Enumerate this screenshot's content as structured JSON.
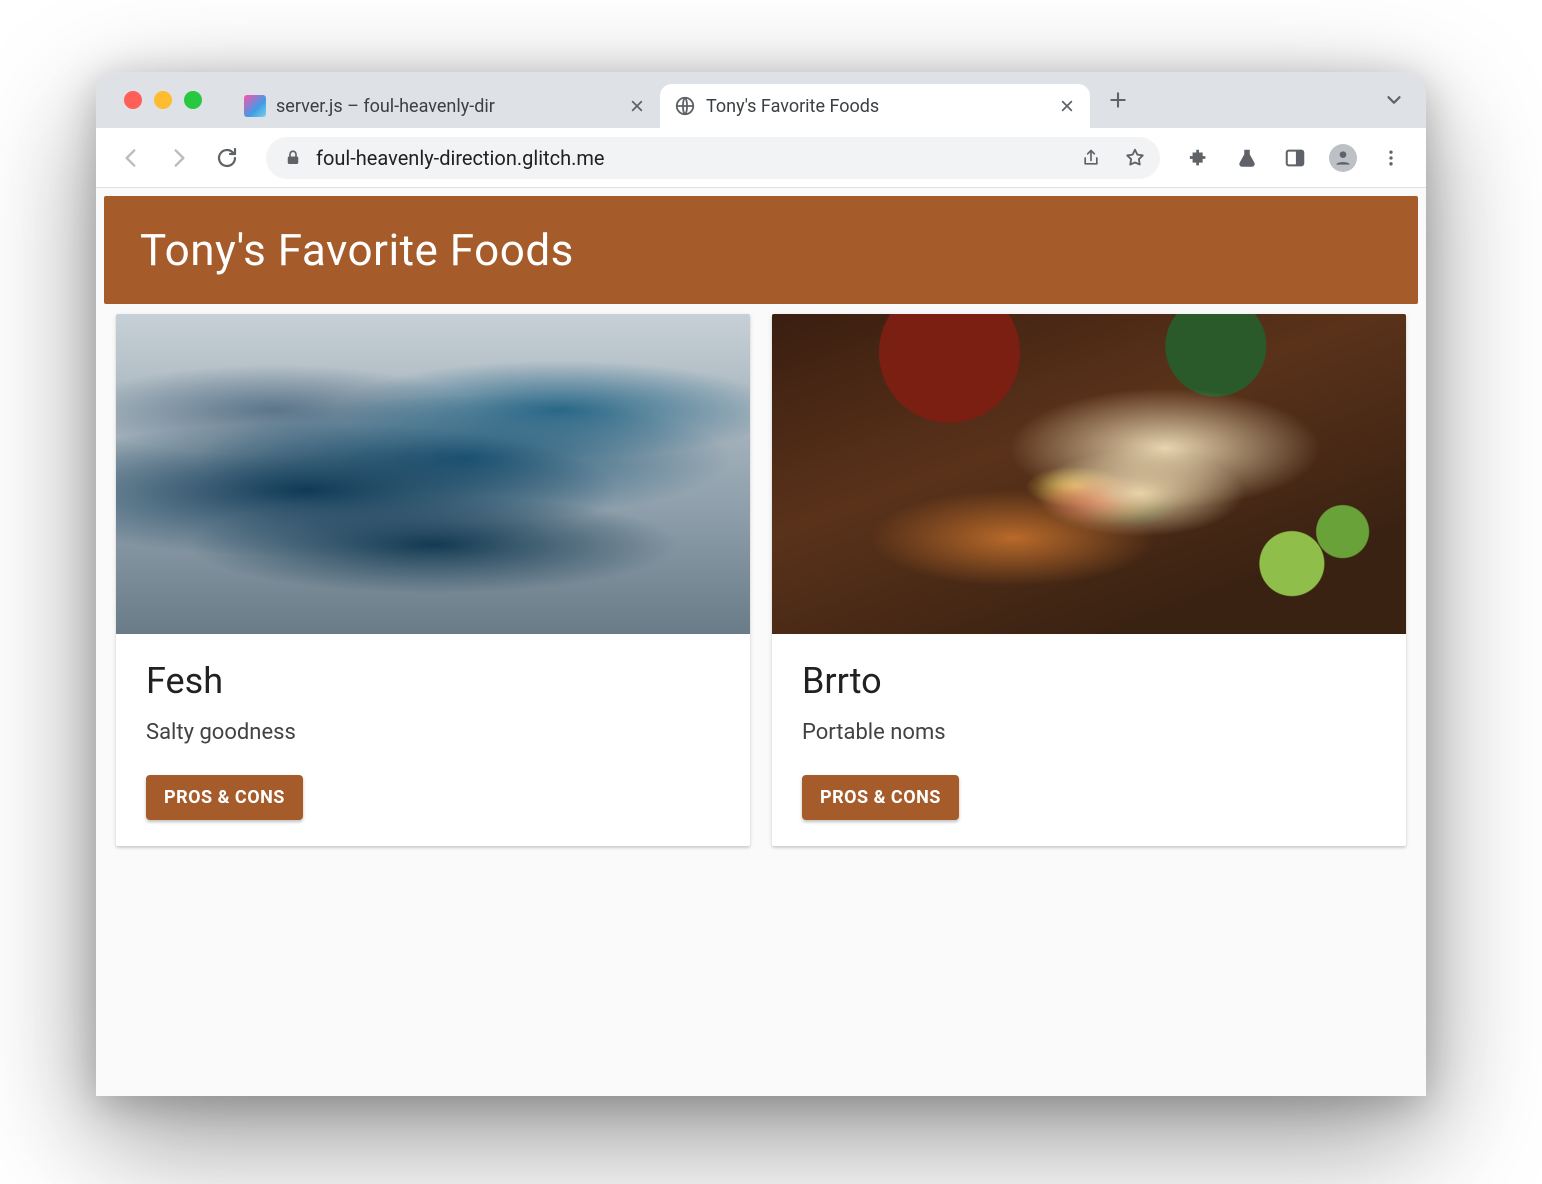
{
  "browser": {
    "tabs": [
      {
        "title": "server.js – foul-heavenly-dir",
        "active": false,
        "favicon": "glitch"
      },
      {
        "title": "Tony's Favorite Foods",
        "active": true,
        "favicon": "globe"
      }
    ],
    "url": "foul-heavenly-direction.glitch.me"
  },
  "page": {
    "title": "Tony's Favorite Foods",
    "cards": [
      {
        "title": "Fesh",
        "desc": "Salty goodness",
        "button": "PROS & CONS",
        "image": "fish"
      },
      {
        "title": "Brrto",
        "desc": "Portable noms",
        "button": "PROS & CONS",
        "image": "burrito"
      }
    ]
  },
  "colors": {
    "accent": "#a65c2a"
  }
}
